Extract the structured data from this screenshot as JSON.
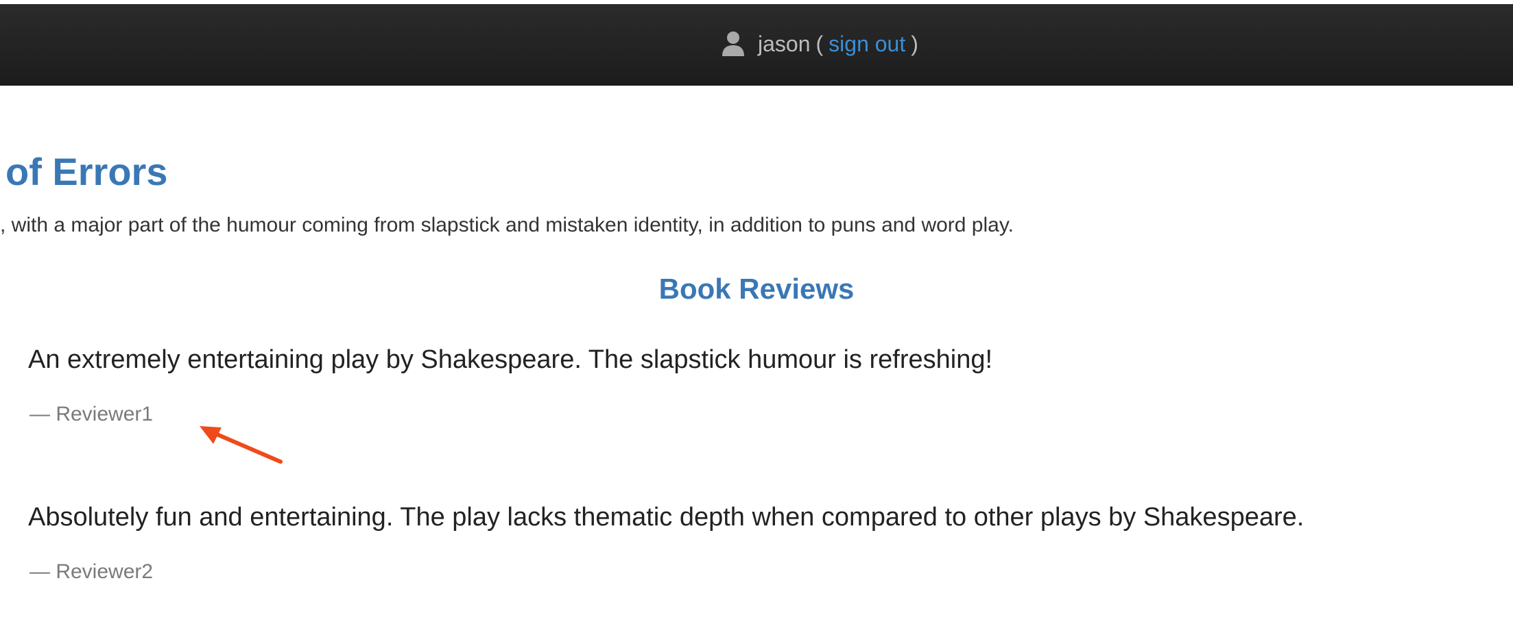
{
  "navbar": {
    "icon": "user-icon",
    "username": "jason",
    "open_paren": "(",
    "signout_label": "sign out",
    "close_paren": ")"
  },
  "book": {
    "title": "of Errors",
    "description": ", with a major part of the humour coming from slapstick and mistaken identity, in addition to puns and word play."
  },
  "reviews": {
    "heading": "Book Reviews",
    "items": [
      {
        "text": "An extremely entertaining play by Shakespeare. The slapstick humour is refreshing!",
        "author": "— Reviewer1"
      },
      {
        "text": "Absolutely fun and entertaining. The play lacks thematic depth when compared to other plays by Shakespeare.",
        "author": "— Reviewer2"
      }
    ]
  },
  "annotation": {
    "icon": "arrow-icon",
    "color": "#f04a1a"
  },
  "colors": {
    "accent": "#3a78b5",
    "link": "#3b8fd6",
    "navbar": "#232323"
  }
}
